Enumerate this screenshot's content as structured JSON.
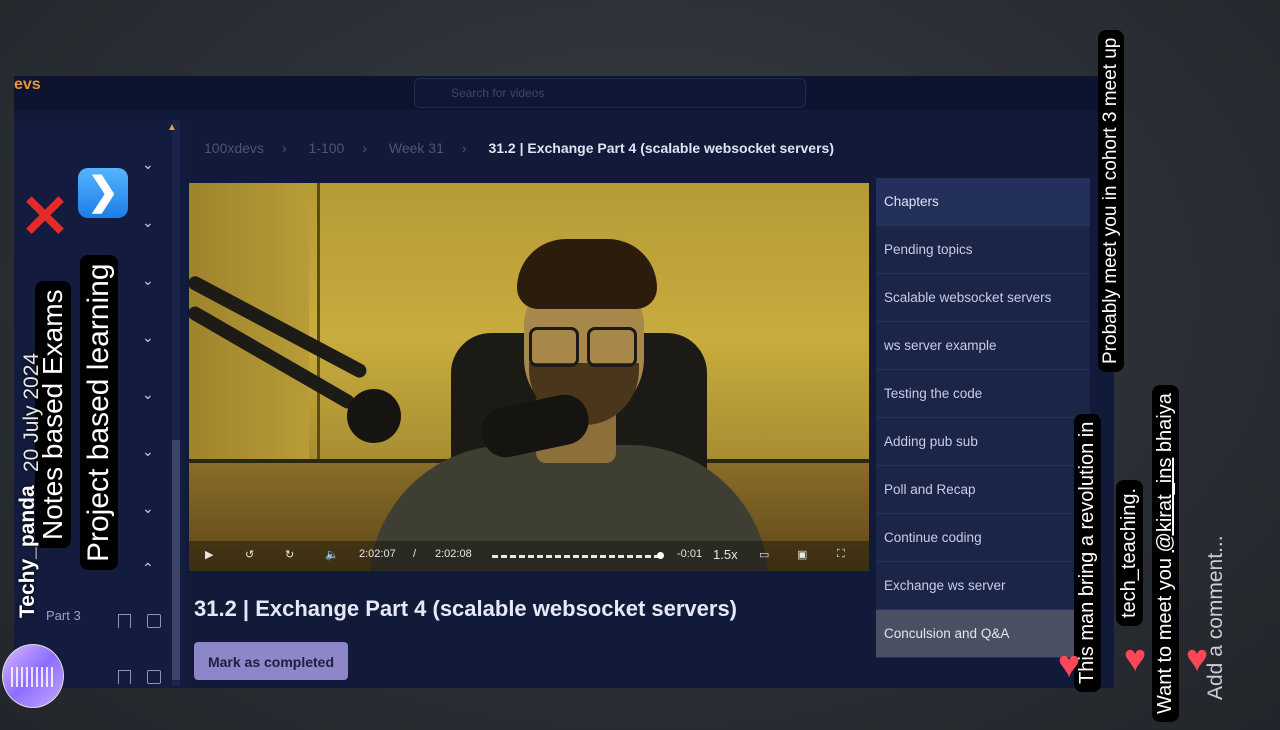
{
  "app": {
    "logo_text": "evs",
    "search_placeholder": "Search for videos"
  },
  "breadcrumb": [
    "100xdevs",
    "1-100",
    "Week 31",
    "31.2 | Exchange Part 4 (scalable websocket servers)"
  ],
  "sidebar": {
    "part_label": "Part 3"
  },
  "player": {
    "current_time": "2:02:07",
    "separator": "/",
    "duration": "2:02:08",
    "remaining": "-0:01",
    "speed": "1.5x",
    "progress": 0.99
  },
  "chapters": {
    "items": [
      "Chapters",
      "Pending topics",
      "Scalable websocket servers",
      "ws server example",
      "Testing the code",
      "Adding pub sub",
      "Poll and Recap",
      "Continue coding",
      "Exchange ws server",
      "Conculsion and Q&A"
    ]
  },
  "video": {
    "title": "31.2 | Exchange Part 4 (scalable websocket servers)",
    "mark_completed": "Mark as completed"
  },
  "story": {
    "user_name": "Techy_panda",
    "date": "20 July 2024",
    "notes_text": "Notes based Exams",
    "project_text": "Project based learning",
    "meet_text": "Probably meet you in cohort 3 meet up",
    "revolution_text": "This man bring a revolution in",
    "teaching_text": "tech_teaching.",
    "want_meet_text": "Want to meet you",
    "handle": "@kirat_ins",
    "bhaiya": "bhaiya",
    "comment_placeholder": "Add a comment...",
    "icons": [
      "cross-mark-icon",
      "arrow-right-icon",
      "heart-icon"
    ],
    "colors": {
      "heart": "#ff4757",
      "cross": "#e52a2a",
      "arrow_bg": "#1b7ee6",
      "accent": "#e8953a"
    }
  }
}
